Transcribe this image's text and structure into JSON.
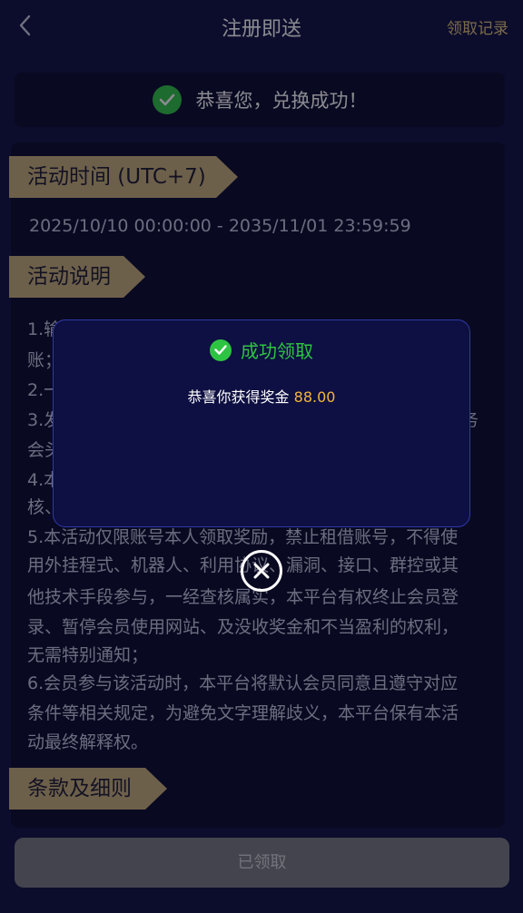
{
  "header": {
    "title": "注册即送",
    "records_link": "领取记录",
    "back_icon": "chevron-left-icon"
  },
  "banner": {
    "text": "恭喜您，兑换成功！",
    "icon": "check-circle-icon",
    "icon_color": "#2ec443"
  },
  "sections": {
    "time_label": "活动时间 (UTC+7)",
    "time_range": "2025/10/10 00:00:00 - 2035/11/01 23:59:59",
    "desc_label": "活动说明",
    "terms_label": "条款及细则"
  },
  "rules": [
    "1.输",
    "账；",
    "2.一",
    "3.发",
    "务",
    "会头",
    "4.本",
    "核、",
    "5.本活动仅限账号本人领取奖励，禁止租借账号，不得使",
    "用外挂程式、机器人、利用协议、漏洞、接口、群控或其",
    "他技术手段参与，一经查核属实，本平台有权终止会员登",
    "录、暂停会员使用网站、及没收奖金和不当盈利的权利，",
    "无需特别通知；",
    "6.会员参与该活动时，本平台将默认会员同意且遵守对应",
    "条件等相关规定，为避免文字理解歧义，本平台保有本活",
    "动最终解释权。"
  ],
  "bottom": {
    "button_label": "已领取"
  },
  "dialog": {
    "title": "成功领取",
    "message": "恭喜你获得奖金",
    "amount": "88.00",
    "title_color": "#2ec443",
    "amount_color": "#f2b63b",
    "close_icon": "close-circle-icon"
  },
  "colors": {
    "background": "#0f1140",
    "card": "#08092d",
    "ribbon_gold": "#c8ae7a",
    "link_gold": "#e3c27a"
  }
}
